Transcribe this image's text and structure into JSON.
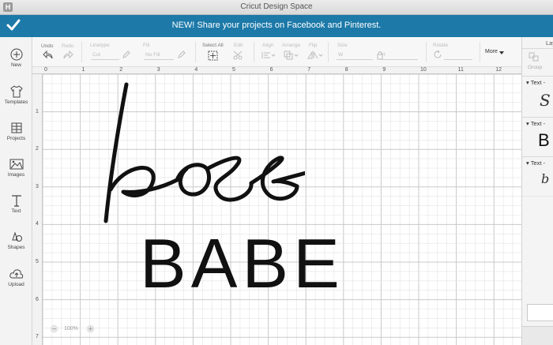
{
  "window": {
    "title": "Cricut Design Space",
    "app_icon_letter": "H"
  },
  "banner": {
    "text": "NEW! Share your projects on Facebook and Pinterest.",
    "icon": "checkmark-icon"
  },
  "sidebar": {
    "items": [
      {
        "label": "New",
        "icon": "plus-circle-icon"
      },
      {
        "label": "Templates",
        "icon": "tshirt-icon"
      },
      {
        "label": "Projects",
        "icon": "projects-grid-icon"
      },
      {
        "label": "Images",
        "icon": "image-icon"
      },
      {
        "label": "Text",
        "icon": "text-t-icon"
      },
      {
        "label": "Shapes",
        "icon": "shapes-icon"
      },
      {
        "label": "Upload",
        "icon": "cloud-upload-icon"
      }
    ]
  },
  "toolbar": {
    "undo": "Undo",
    "redo": "Redo",
    "linetype": "Linetype",
    "linetype_value": "Cut",
    "fill": "Fill",
    "fill_value": "No Fill",
    "select_all": "Select All",
    "edit": "Edit",
    "align": "Align",
    "arrange": "Arrange",
    "flip": "Flip",
    "size": "Size",
    "size_w": "W",
    "size_h": "H",
    "rotate": "Rotate",
    "more": "More"
  },
  "rulers": {
    "top": [
      "0",
      "1",
      "2",
      "3",
      "4",
      "5",
      "6",
      "7",
      "8",
      "9",
      "10",
      "11",
      "12"
    ],
    "left": [
      "1",
      "2",
      "3",
      "4",
      "5",
      "6",
      "7"
    ]
  },
  "canvas": {
    "script_text": "boss",
    "block_text": "BABE",
    "zoom": "100%"
  },
  "layers_panel": {
    "header": "Lay",
    "group_label": "Group",
    "layers": [
      {
        "label": "Text",
        "preview": "S"
      },
      {
        "label": "Text",
        "preview": "B"
      },
      {
        "label": "Text",
        "preview": "b"
      }
    ]
  },
  "colors": {
    "banner": "#1c79a8",
    "grid_minor": "#e3e3e3",
    "grid_major": "#c9c9c9"
  }
}
